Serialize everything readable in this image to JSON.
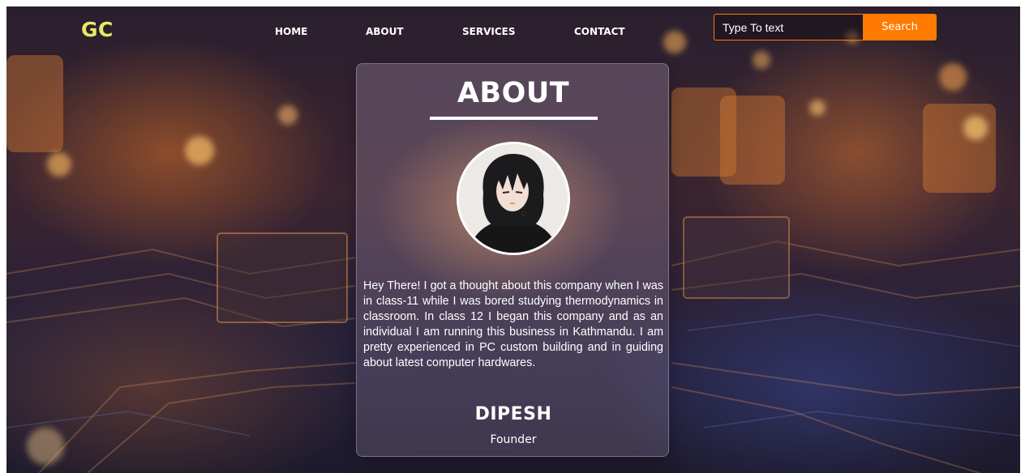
{
  "brand": {
    "logo_text": "GC"
  },
  "nav": {
    "items": [
      {
        "label": "HOME"
      },
      {
        "label": "ABOUT"
      },
      {
        "label": "SERVICES"
      },
      {
        "label": "CONTACT"
      }
    ]
  },
  "search": {
    "placeholder": "Type To text",
    "value": "",
    "button_label": "Search"
  },
  "about_card": {
    "title": "ABOUT",
    "bio": "Hey There! I got a thought about this company when I was in class-11 while I was bored studying thermodynamics in classroom. In class 12 I began this company and as an individual I am running this business in Kathmandu. I am pretty experienced in PC custom building and in guiding about latest computer hardwares.",
    "name": "DIPESH",
    "role": "Founder"
  },
  "colors": {
    "logo": "#e8e868",
    "accent": "#ff7a00",
    "text": "#ffffff"
  },
  "icons": {
    "avatar": "founder-avatar-illustration"
  }
}
